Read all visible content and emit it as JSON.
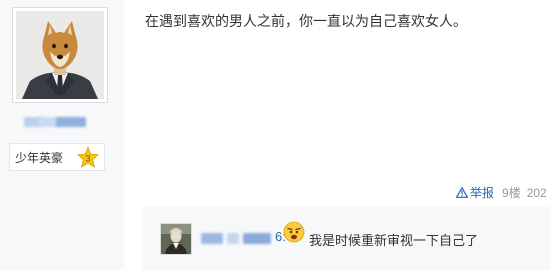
{
  "author": {
    "avatar_icon": "shiba-dog-in-suit-avatar",
    "username": "",
    "badge": {
      "label": "少年英豪",
      "level": "3",
      "star_color": "#f5c518"
    }
  },
  "post": {
    "content": "在遇到喜欢的男人之前，你一直以为自己喜欢女人。",
    "report_label": "举报",
    "floor": "9楼",
    "date": "202"
  },
  "reply": {
    "avatar_icon": "person-avatar",
    "username": "",
    "username_suffix": "6:",
    "emoji_icon": "anxious-face-emoji",
    "content": "我是时候重新审视一下自己了"
  },
  "colors": {
    "link": "#2d64b3",
    "sidebar_bg": "#f7f8fa",
    "meta_gray": "#999999"
  }
}
